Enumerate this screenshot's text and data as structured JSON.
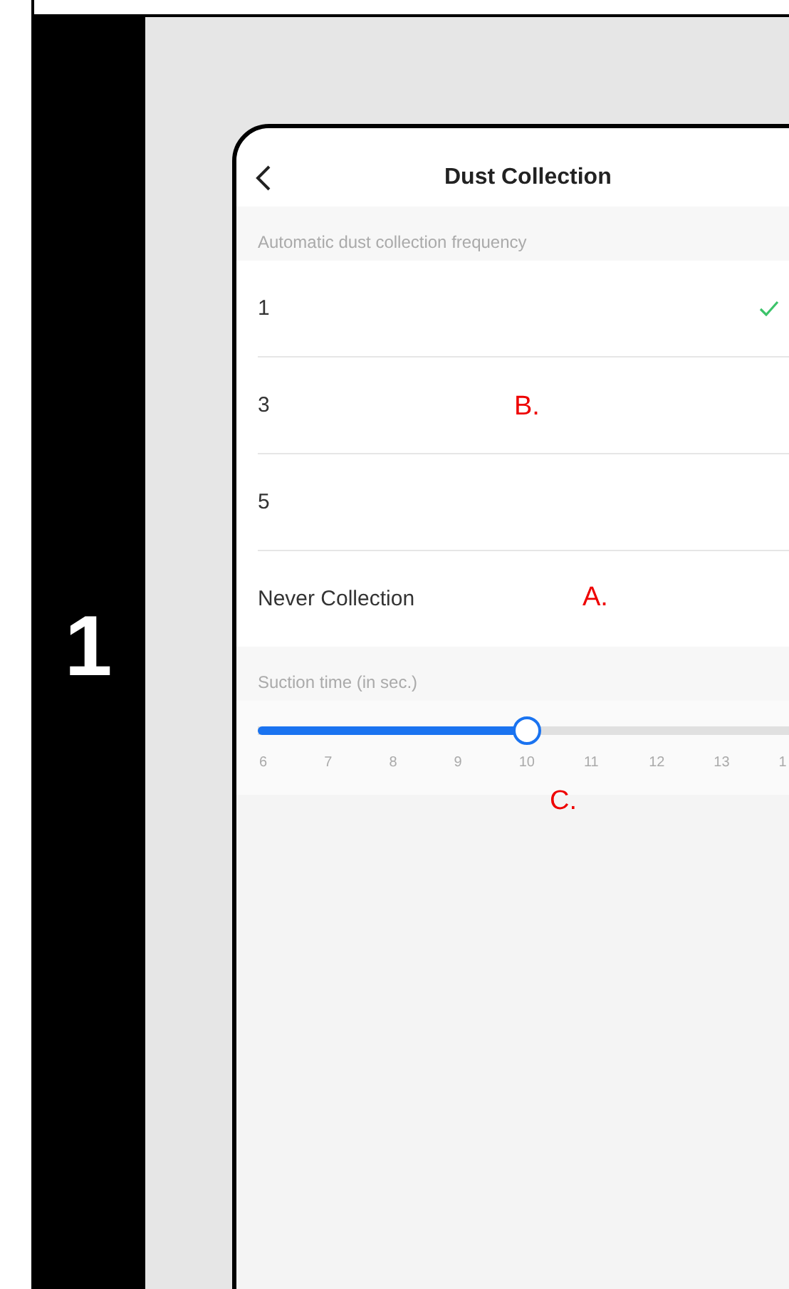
{
  "step": {
    "number": "1"
  },
  "screen": {
    "title": "Dust Collection",
    "section_header": "Automatic dust collection frequency",
    "options": [
      {
        "label": "1",
        "selected": true
      },
      {
        "label": "3",
        "selected": false,
        "annotation": "B."
      },
      {
        "label": "5",
        "selected": false
      },
      {
        "label": "Never Collection",
        "selected": false,
        "annotation": "A."
      }
    ],
    "slider_header": "Suction time (in sec.)",
    "slider": {
      "level": 0.45,
      "ticks": [
        "6",
        "7",
        "8",
        "9",
        "10",
        "11",
        "12",
        "13",
        "1"
      ],
      "annotation": "C."
    }
  }
}
